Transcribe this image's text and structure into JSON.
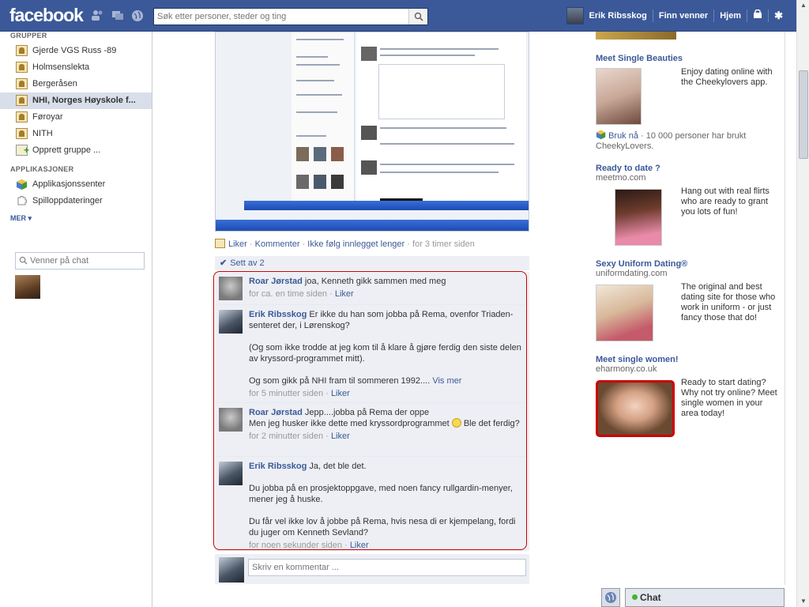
{
  "header": {
    "logo": "facebook",
    "search_placeholder": "Søk etter personer, steder og ting",
    "user_name": "Erik Ribsskog",
    "nav": [
      "Finn venner",
      "Hjem"
    ]
  },
  "sidebar": {
    "groups_title": "GRUPPER",
    "groups": [
      {
        "label": "Gjerde VGS Russ -89"
      },
      {
        "label": "Holmsenslekta"
      },
      {
        "label": "Bergeråsen"
      },
      {
        "label": "NHI, Norges Høyskole f..."
      },
      {
        "label": "Føroyar"
      },
      {
        "label": "NITH"
      }
    ],
    "create_group": "Opprett gruppe ...",
    "apps_title": "APPLIKASJONER",
    "apps": [
      {
        "label": "Applikasjonssenter"
      },
      {
        "label": "Spilloppdateringer"
      }
    ],
    "more": "MER",
    "chat_search_placeholder": "Venner på chat"
  },
  "post": {
    "actions": {
      "like": "Liker",
      "comment": "Kommenter",
      "unfollow": "Ikke følg innlegget lenger",
      "time": "for 3 timer siden"
    },
    "seen_by": "Sett av 2",
    "comments": [
      {
        "author": "Roar Jørstad",
        "text": "joa, Kenneth gikk sammen med meg",
        "time": "for ca. en time siden",
        "like": "Liker"
      },
      {
        "author": "Erik Ribsskog",
        "text": "Er ikke du han som jobba på Rema, ovenfor Triaden-senteret der, i Lørenskog?",
        "text2": "(Og som ikke trodde at jeg kom til å klare å gjøre ferdig den siste delen av kryssord-programmet mitt).",
        "text3": "Og som gikk på NHI fram til sommeren 1992....",
        "see_more": "Vis mer",
        "time": "for 5 minutter siden",
        "like": "Liker"
      },
      {
        "author": "Roar Jørstad",
        "text": "Jepp....jobba på Rema der oppe",
        "text2": "Men jeg husker ikke dette med kryssordprogrammet",
        "text3": "Ble det ferdig?",
        "time": "for 2 minutter siden",
        "like": "Liker"
      },
      {
        "author": "Erik Ribsskog",
        "text": "Ja, det ble det.",
        "text2": "Du jobba på en prosjektoppgave, med noen fancy rullgardin-menyer, mener jeg å huske.",
        "text3": "Du får vel ikke lov å jobbe på Rema, hvis nesa di er kjempelang, fordi du juger om Kenneth Sevland?",
        "time": "for noen sekunder siden",
        "like": "Liker"
      }
    ],
    "new_comment_placeholder": "Skriv en kommentar ..."
  },
  "ads": [
    {
      "title": "Meet Single Beauties",
      "domain": "",
      "text": "Enjoy dating online with the Cheekylovers app.",
      "extra_link": "Bruk nå",
      "extra_text": "· 10 000 personer har brukt CheekyLovers."
    },
    {
      "title": "Ready to date ?",
      "domain": "meetmo.com",
      "text": "Hang out with real flirts who are ready to grant you lots of fun!"
    },
    {
      "title": "Sexy Uniform Dating®",
      "domain": "uniformdating.com",
      "text": "The original and best dating site for those who work in uniform - or just fancy those that do!"
    },
    {
      "title": "Meet single women!",
      "domain": "eharmony.co.uk",
      "text": "Ready to start dating? Why not try online? Meet single women in your area today!"
    }
  ],
  "chat": {
    "label": "Chat"
  },
  "colors": {
    "brand": "#3b5998",
    "highlight": "#cc0000"
  }
}
